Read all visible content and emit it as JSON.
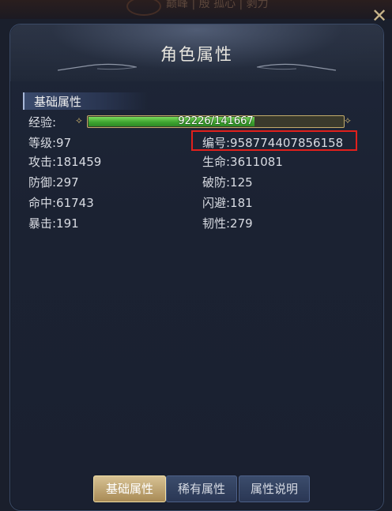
{
  "top_bar": {
    "ghost_text": "巅峰 | 殷 孤心 | 剥力",
    "close_icon": "close-icon"
  },
  "title": "角色属性",
  "section": {
    "label": "基础属性"
  },
  "exp": {
    "label": "经验:",
    "current": 92226,
    "max": 141667,
    "text": "92226/141667"
  },
  "stats": {
    "level": "等级:97",
    "id": "编号:958774407856158",
    "attack": "攻击:181459",
    "hp": "生命:3611081",
    "defense": "防御:297",
    "armor_break": "破防:125",
    "hit": "命中:61743",
    "dodge": "闪避:181",
    "crit": "暴击:191",
    "toughness": "韧性:279"
  },
  "tabs": [
    {
      "label": "基础属性",
      "active": true
    },
    {
      "label": "稀有属性",
      "active": false
    },
    {
      "label": "属性说明",
      "active": false
    }
  ],
  "colors": {
    "highlight": "#e0201c",
    "exp_fill": "#4fb83c",
    "tab_active": "#c7ad78"
  }
}
